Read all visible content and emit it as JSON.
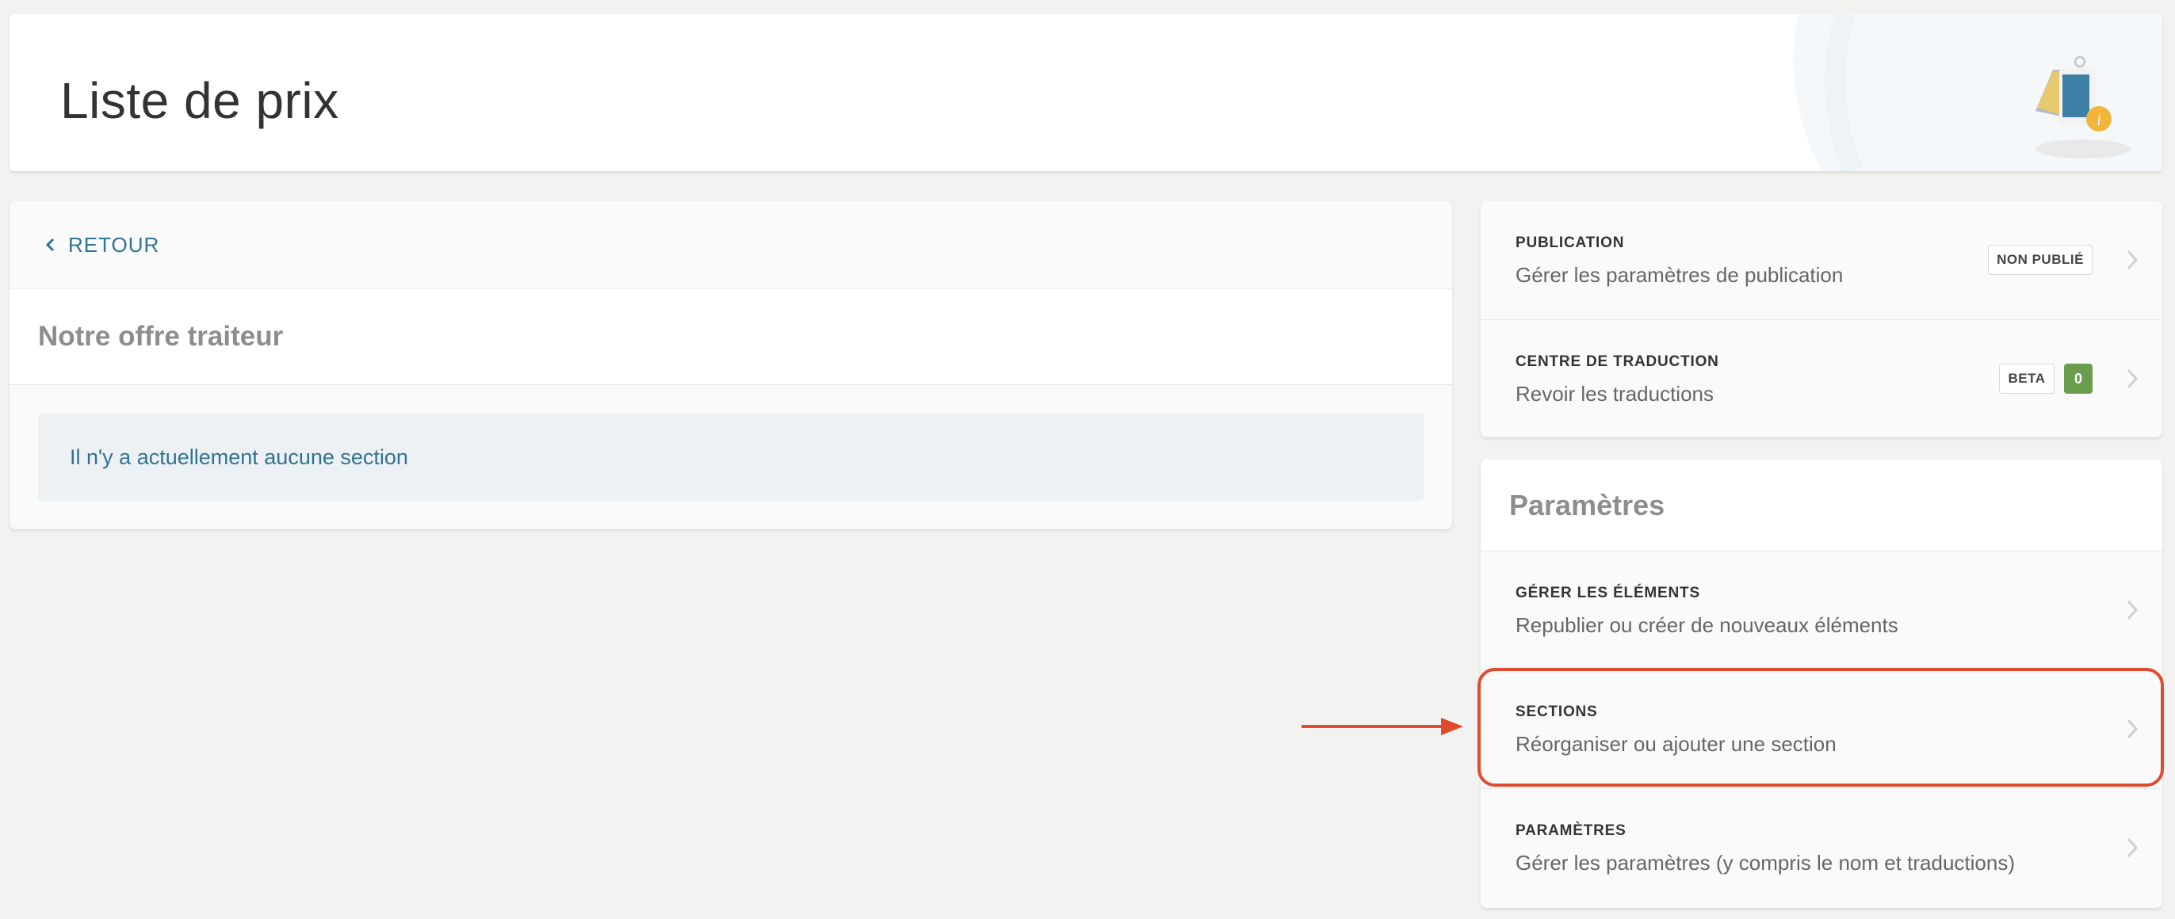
{
  "header": {
    "title": "Liste de prix"
  },
  "left": {
    "back_label": "RETOUR",
    "offer_title": "Notre offre traiteur",
    "empty_message": "Il n'y a actuellement aucune section"
  },
  "publication": {
    "label": "PUBLICATION",
    "desc": "Gérer les paramètres de publication",
    "badge": "NON PUBLIÉ"
  },
  "translation": {
    "label": "CENTRE DE TRADUCTION",
    "desc": "Revoir les traductions",
    "badge": "BETA",
    "count": "0"
  },
  "settings": {
    "title": "Paramètres",
    "items": [
      {
        "label": "GÉRER LES ÉLÉMENTS",
        "desc": "Republier ou créer de nouveaux éléments"
      },
      {
        "label": "SECTIONS",
        "desc": "Réorganiser ou ajouter une section"
      },
      {
        "label": "PARAMÈTRES",
        "desc": "Gérer les paramètres (y compris le nom et traductions)"
      }
    ]
  },
  "colors": {
    "accent": "#2f7393",
    "highlight": "#e04a2f",
    "count_badge": "#6a9e4e"
  },
  "icons": [
    "chevron-left-icon",
    "chevron-right-icon",
    "price-tag-logo-icon",
    "annotation-arrow-icon"
  ]
}
